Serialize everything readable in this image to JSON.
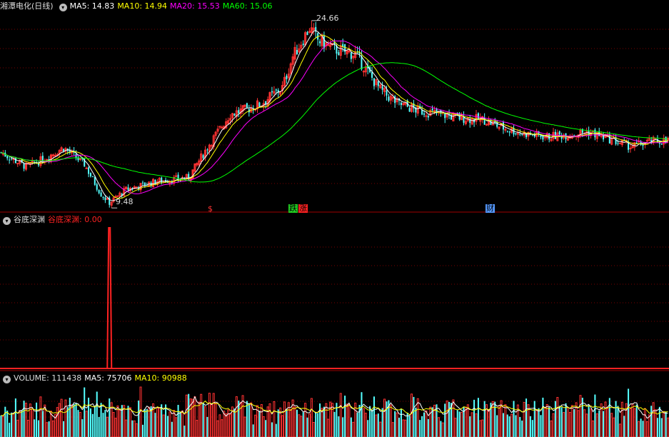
{
  "main_panel": {
    "title": "湘潭电化(日线)",
    "ma": [
      {
        "label": "MA5: 14.83",
        "color": "#ffffff"
      },
      {
        "label": "MA10: 14.94",
        "color": "#ffff00"
      },
      {
        "label": "MA20: 15.53",
        "color": "#ff00ff"
      },
      {
        "label": "MA60: 15.06",
        "color": "#00ff00"
      }
    ],
    "high_label": "24.66",
    "low_label": "9.48",
    "markers": [
      {
        "text": "$",
        "color": "#ff3333",
        "bg": ""
      },
      {
        "text": "跌",
        "color": "#000000",
        "bg": "#22cc22"
      },
      {
        "text": "涨",
        "color": "#000000",
        "bg": "#ff2222"
      },
      {
        "text": "财",
        "color": "#000000",
        "bg": "#5599ff"
      }
    ]
  },
  "indicator_panel": {
    "title": "谷底深渊",
    "value_label": "谷底深渊: 0.00",
    "value_color": "#ff2222"
  },
  "volume_panel": {
    "title": "VOLUME: 111438",
    "ma5_label": "MA5: 75706",
    "ma10_label": "MA10: 90988",
    "ma5_color": "#ffffff",
    "ma10_color": "#ffff00"
  },
  "chart_data": {
    "type": "candlestick",
    "title": "湘潭电化(日线)",
    "up_color": "#ff3232",
    "down_color": "#54ffff",
    "price_anchors": [
      [
        0,
        13.8
      ],
      [
        12,
        12.6
      ],
      [
        20,
        13.2
      ],
      [
        30,
        14.2
      ],
      [
        40,
        12.8
      ],
      [
        48,
        10.3
      ],
      [
        52,
        9.6
      ],
      [
        60,
        10.7
      ],
      [
        75,
        11.4
      ],
      [
        90,
        11.7
      ],
      [
        100,
        14.5
      ],
      [
        110,
        17.0
      ],
      [
        118,
        17.4
      ],
      [
        125,
        17.9
      ],
      [
        135,
        19.2
      ],
      [
        140,
        21.8
      ],
      [
        148,
        24.2
      ],
      [
        152,
        23.2
      ],
      [
        160,
        22.4
      ],
      [
        170,
        22.0
      ],
      [
        182,
        19.0
      ],
      [
        190,
        17.9
      ],
      [
        200,
        17.3
      ],
      [
        210,
        17.0
      ],
      [
        220,
        16.7
      ],
      [
        232,
        16.5
      ],
      [
        240,
        15.9
      ],
      [
        250,
        15.4
      ],
      [
        262,
        15.1
      ],
      [
        272,
        15.3
      ],
      [
        282,
        15.5
      ],
      [
        292,
        14.9
      ],
      [
        302,
        14.3
      ],
      [
        312,
        14.7
      ],
      [
        320,
        14.8
      ]
    ],
    "high": 24.66,
    "low": 9.48,
    "indicator": {
      "name": "谷底深渊",
      "spike_at": 52,
      "spike_value": 1,
      "value": 0.0
    },
    "volume": {
      "last": 111438,
      "ma5": 75706,
      "ma10": 90988
    }
  }
}
